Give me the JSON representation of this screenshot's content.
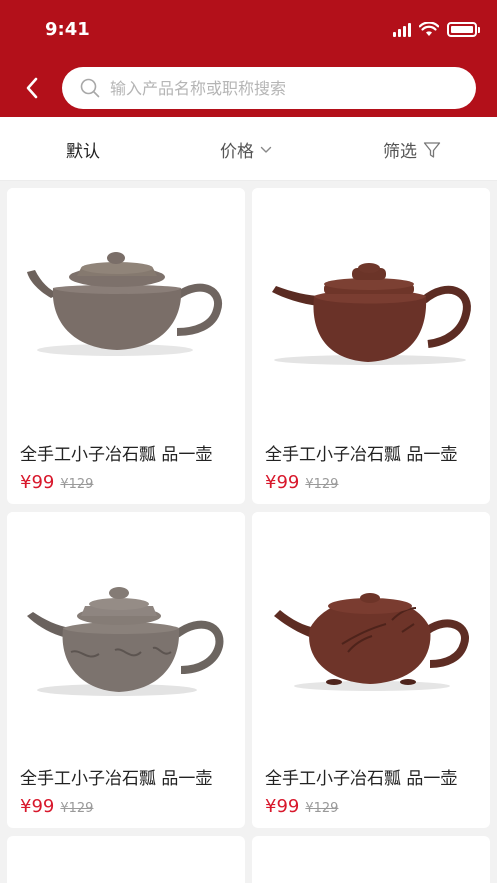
{
  "status_bar": {
    "time": "9:41"
  },
  "search": {
    "placeholder": "输入产品名称或职称搜索"
  },
  "filters": {
    "default": "默认",
    "price": "价格",
    "filter": "筛选"
  },
  "colors": {
    "brand": "#b3101a",
    "price": "#d8182c"
  },
  "products": [
    {
      "title": "全手工小子冶石瓢 品一壶",
      "price": "¥99",
      "old_price": "¥129",
      "image": "teapot-grey-round"
    },
    {
      "title": "全手工小子冶石瓢 品一壶",
      "price": "¥99",
      "old_price": "¥129",
      "image": "teapot-purple-flat"
    },
    {
      "title": "全手工小子冶石瓢 品一壶",
      "price": "¥99",
      "old_price": "¥129",
      "image": "teapot-grey-calligraphy"
    },
    {
      "title": "全手工小子冶石瓢 品一壶",
      "price": "¥99",
      "old_price": "¥129",
      "image": "teapot-brown-bamboo"
    }
  ]
}
